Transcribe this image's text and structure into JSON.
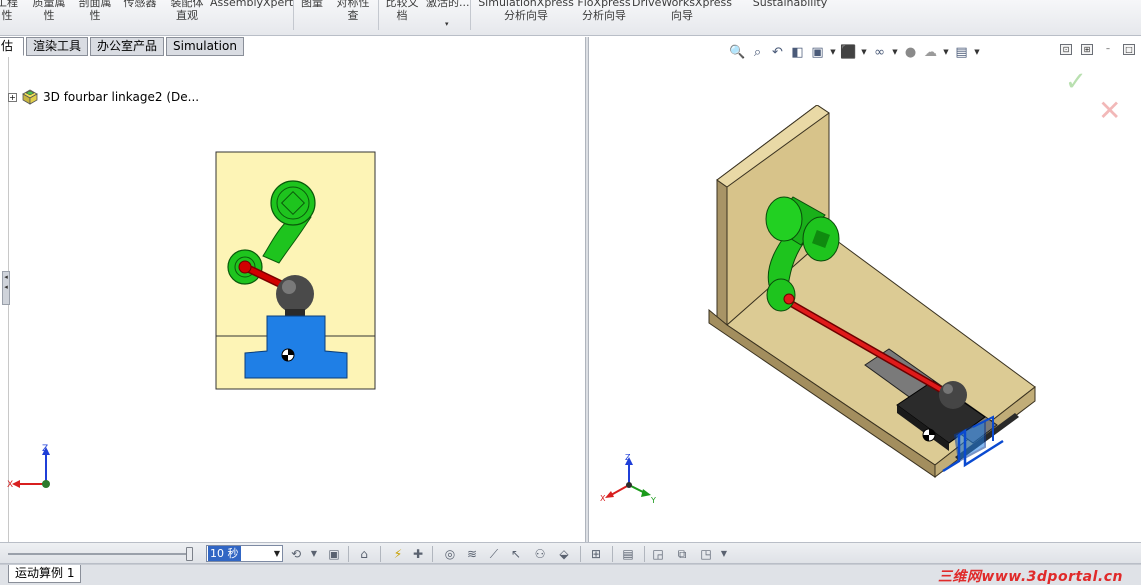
{
  "ribbon": {
    "items": [
      {
        "label": "工程\n性"
      },
      {
        "label": "质量属\n性"
      },
      {
        "label": "剖面属\n性"
      },
      {
        "label": "传感器"
      },
      {
        "label": "装配体\n直观"
      },
      {
        "label": "AssemblyXpert"
      },
      {
        "label": "图量"
      },
      {
        "label": "对称性\n查"
      },
      {
        "label": "比较文\n档"
      },
      {
        "label": "激活的..."
      },
      {
        "label": "SimulationXpress\n分析向导"
      },
      {
        "label": "FloXpress\n分析向导"
      },
      {
        "label": "DriveWorksXpress\n向导"
      },
      {
        "label": "Sustainability"
      }
    ]
  },
  "command_tabs": [
    {
      "label": "估",
      "active": true
    },
    {
      "label": "渲染工具",
      "active": false
    },
    {
      "label": "办公室产品",
      "active": false
    },
    {
      "label": "Simulation",
      "active": false
    }
  ],
  "feature_tree": {
    "node_label": "3D fourbar linkage2  (De...",
    "expander": "+"
  },
  "left_triad": {
    "z": "Z",
    "x": "X"
  },
  "right_triad": {
    "z": "Z",
    "x": "X",
    "y": "Y"
  },
  "heads_up_toolbar": {
    "icons": [
      "zoom-to-fit-icon",
      "zoom-to-area-icon",
      "previous-view-icon",
      "section-view-icon",
      "view-orientation-icon",
      "display-style-icon",
      "hide-show-items-icon",
      "edit-appearance-icon",
      "apply-scene-icon",
      "view-settings-icon"
    ]
  },
  "window_controls": {
    "tile": "⊡",
    "restore": "⊞",
    "minimize": "–",
    "maximize": "□"
  },
  "confirm": {
    "ok": "✓",
    "cancel": "✕"
  },
  "motion_toolbar": {
    "time_value": "10 秒",
    "time_unit_options_arrow": "▼"
  },
  "study_tab": {
    "label": "运动算例 1"
  },
  "watermark": {
    "text": "三维网www.3dportal.cn"
  },
  "colors": {
    "green_link": "#1ec41e",
    "red_rod": "#d10000",
    "blue_slider": "#1f7fe6",
    "base_tan": "#d9c48a",
    "drawing_bg": "#fdf4b6",
    "selection": "#3166c4"
  }
}
